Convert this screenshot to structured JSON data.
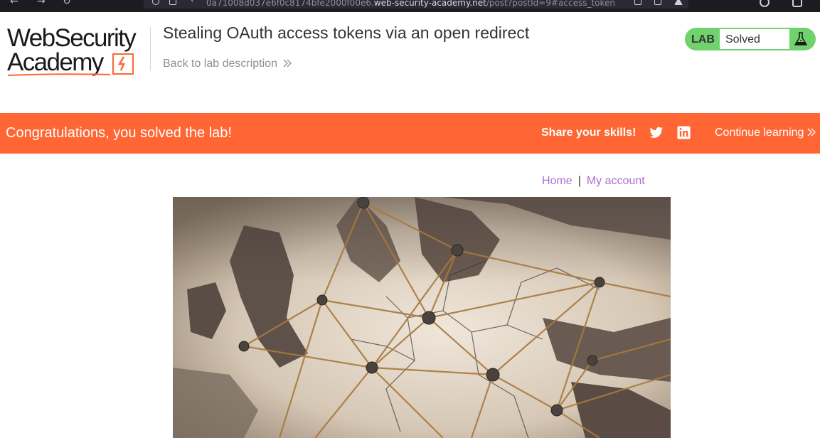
{
  "browser": {
    "url_prefix": "0a71008d037e6f0c8174bfe2000f00e6.",
    "url_domain": "web-security-academy.net",
    "url_suffix": "/post?postId=9#access_token"
  },
  "header": {
    "logo_line1": "WebSecurity",
    "logo_line2": "Academy",
    "title": "Stealing OAuth access tokens via an open redirect",
    "back_link": "Back to lab description"
  },
  "lab_status": {
    "label": "LAB",
    "status": "Solved",
    "color": "#70d16d"
  },
  "banner": {
    "message": "Congratulations, you solved the lab!",
    "share_label": "Share your skills!",
    "continue_label": "Continue learning",
    "color": "#ff6633",
    "icons": [
      "twitter-icon",
      "linkedin-icon"
    ]
  },
  "nav": {
    "home": "Home",
    "separator": "|",
    "my_account": "My account"
  },
  "colors": {
    "link": "#b06ed1",
    "accent": "#ff6633"
  }
}
